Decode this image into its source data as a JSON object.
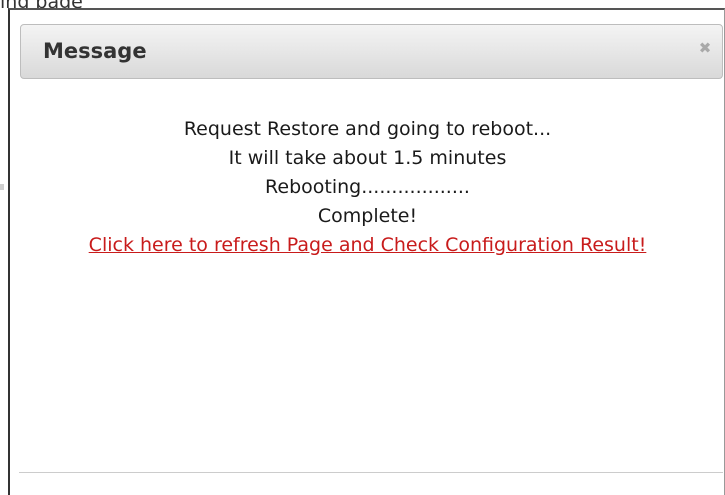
{
  "background": {
    "fragment_text": "ing page"
  },
  "dialog": {
    "title": "Message",
    "close_glyph": "✖",
    "lines": [
      "Request Restore and going to reboot...",
      "It will take about 1.5 minutes",
      "Rebooting..................",
      "Complete!"
    ],
    "link_text": "Click here to refresh Page and Check Configuration Result!",
    "colors": {
      "link": "#c81b1b",
      "title_bar_top": "#f4f4f4",
      "title_bar_bottom": "#d9d9d9",
      "text": "#1a1a1a"
    },
    "icons": {
      "close": "close-icon"
    }
  }
}
